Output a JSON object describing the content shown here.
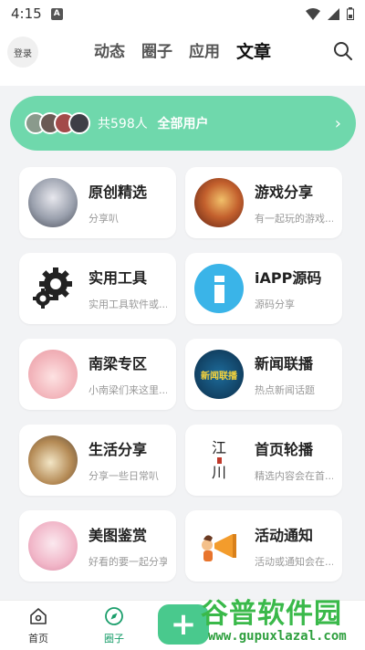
{
  "status_bar": {
    "time": "4:15",
    "notif": "A"
  },
  "header": {
    "login_label": "登录",
    "tabs": [
      {
        "label": "动态"
      },
      {
        "label": "圈子"
      },
      {
        "label": "应用"
      },
      {
        "label": "文章"
      }
    ],
    "active_tab": "文章"
  },
  "banner": {
    "count_text": "共598人",
    "all_users_label": "全部用户",
    "arrow": "›",
    "color": "#6fd8ac"
  },
  "cards": [
    {
      "title": "原创精选",
      "subtitle": "分享叭"
    },
    {
      "title": "游戏分享",
      "subtitle": "有一起玩的游戏..."
    },
    {
      "title": "实用工具",
      "subtitle": "实用工具软件或..."
    },
    {
      "title": "iAPP源码",
      "subtitle": "源码分享"
    },
    {
      "title": "南梁专区",
      "subtitle": "小南梁们来这里..."
    },
    {
      "title": "新闻联播",
      "subtitle": "热点新闻话题"
    },
    {
      "title": "生活分享",
      "subtitle": "分享一些日常叭"
    },
    {
      "title": "首页轮播",
      "subtitle": "精选内容会在首..."
    },
    {
      "title": "美图鉴赏",
      "subtitle": "好看的要一起分享"
    },
    {
      "title": "活动通知",
      "subtitle": "活动或通知会在..."
    }
  ],
  "card_icons": {
    "news_text": "新闻联播",
    "river_text_1": "江",
    "river_text_2": "川"
  },
  "bottom_nav": {
    "home_label": "首页",
    "circle_label": "圈子",
    "fab_symbol": "+"
  },
  "watermark": {
    "main": "谷普软件园",
    "url": "www.gupuxlazal.com"
  },
  "colors": {
    "accent": "#49c98d",
    "active_nav": "#1a9e6b"
  }
}
